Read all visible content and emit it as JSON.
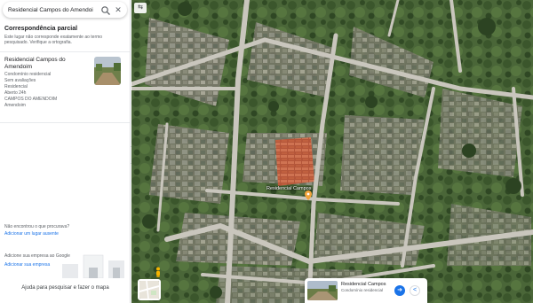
{
  "search": {
    "value": "Residencial Campos do Amendoim",
    "search_icon": "search-icon",
    "close_icon": "close-icon"
  },
  "panel": {
    "header_title": "Correspondência parcial",
    "header_desc": "Este lugar não corresponde exatamente ao termo pesquisado. Verifique a ortografia.",
    "result": {
      "title": "Residencial Campos do Amendoim",
      "lines": [
        "Condomínio residencial",
        "Sem avaliações",
        "Residencial",
        "Aberto 24h",
        "CAMPOS DO AMENDOIM",
        "Amendoim"
      ]
    },
    "missing_text": "Não encontrou o que procurava?",
    "add_link": "Adicionar um lugar ausente",
    "biz_text": "Adicione sua empresa ao Google",
    "biz_link": "Adicionar sua empresa",
    "footer_link": "Ajuda para pesquisar e fazer o mapa"
  },
  "map": {
    "collapse_icon": "chevron-left-icon",
    "top_left_icon": "layers-icon",
    "pin_label": "Residencial Campos",
    "pin_icon": "map-pin-icon",
    "pegman_icon": "pegman-icon",
    "preview": {
      "title": "Residencial Campos",
      "subtitle": "Condomínio residencial",
      "directions_icon": "directions-icon",
      "share_icon": "share-icon"
    }
  },
  "colors": {
    "accent": "#1a73e8",
    "foliage": "#3f5e30",
    "road": "#c9c6bd",
    "roof_orange": "#c8643c"
  }
}
